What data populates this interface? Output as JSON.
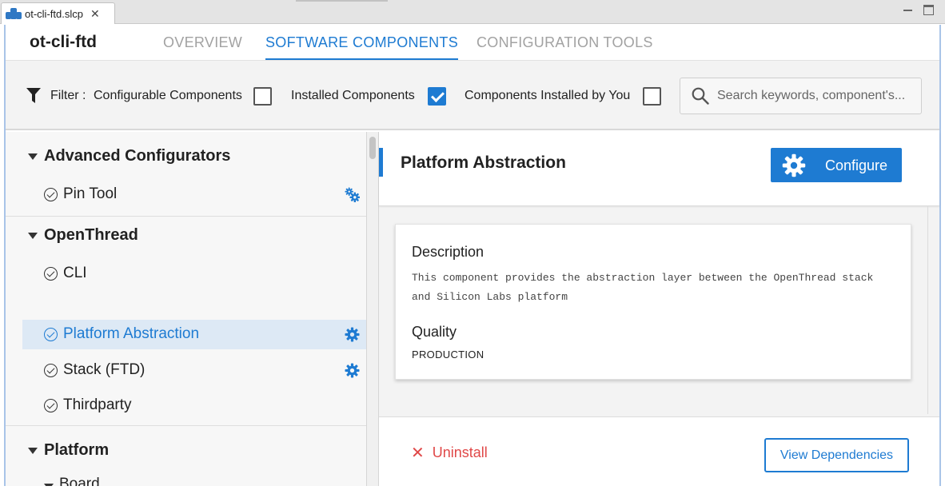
{
  "editor_tab": {
    "title": "ot-cli-ftd.slcp",
    "close_glyph": "✕"
  },
  "header": {
    "project_title": "ot-cli-ftd",
    "tabs": [
      {
        "label": "OVERVIEW",
        "active": false
      },
      {
        "label": "SOFTWARE COMPONENTS",
        "active": true
      },
      {
        "label": "CONFIGURATION TOOLS",
        "active": false
      }
    ]
  },
  "filter": {
    "label": "Filter :",
    "options": [
      {
        "label": "Configurable Components",
        "checked": false
      },
      {
        "label": "Installed Components",
        "checked": true
      },
      {
        "label": "Components Installed by You",
        "checked": false
      }
    ],
    "search_placeholder": "Search keywords, component's..."
  },
  "tree": {
    "groups": [
      {
        "label": "Advanced Configurators",
        "items": [
          {
            "label": "Pin Tool",
            "icon": "gears-icon"
          }
        ]
      },
      {
        "label": "OpenThread",
        "items": [
          {
            "label": "CLI"
          },
          {
            "label": "Platform Abstraction",
            "selected": true,
            "icon": "gear-icon"
          },
          {
            "label": "Stack (FTD)",
            "icon": "gear-icon"
          },
          {
            "label": "Thirdparty"
          }
        ]
      },
      {
        "label": "Platform",
        "subgroups": [
          {
            "label": "Board"
          }
        ]
      }
    ]
  },
  "detail": {
    "title": "Platform Abstraction",
    "configure_label": "Configure",
    "description_heading": "Description",
    "description_text": "This component provides the abstraction layer between the OpenThread stack and Silicon Labs platform",
    "quality_heading": "Quality",
    "quality_value": "PRODUCTION",
    "uninstall_label": "Uninstall",
    "uninstall_glyph": "✕",
    "dependencies_label": "View Dependencies"
  },
  "colors": {
    "accent": "#1e7bd2",
    "danger": "#e04848"
  }
}
